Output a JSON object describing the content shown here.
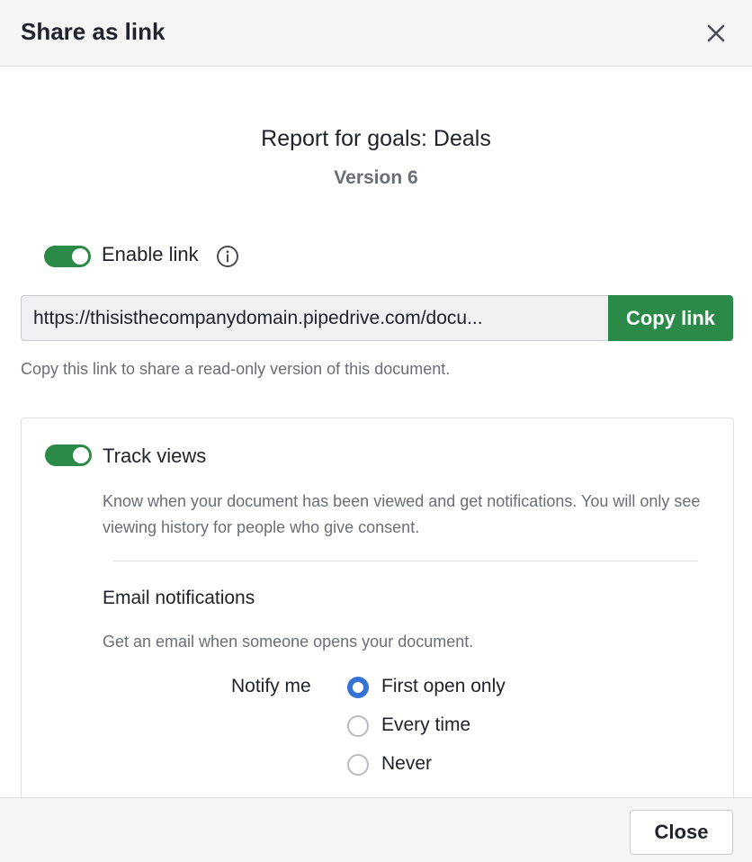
{
  "dialog": {
    "title": "Share as link",
    "close_button_label": "Close"
  },
  "document": {
    "title": "Report for goals: Deals",
    "version": "Version 6"
  },
  "link": {
    "enable_label": "Enable link",
    "enabled": true,
    "url": "https://thisisthecompanydomain.pipedrive.com/docu...",
    "copy_label": "Copy link",
    "helper": "Copy this link to share a read-only version of this document."
  },
  "tracking": {
    "label": "Track views",
    "enabled": true,
    "description": "Know when your document has been viewed and get notifications. You will only see viewing history for people who give consent.",
    "email_title": "Email notifications",
    "email_description": "Get an email when someone opens your document.",
    "notify_label": "Notify me",
    "options": [
      {
        "label": "First open only",
        "selected": true
      },
      {
        "label": "Every time",
        "selected": false
      },
      {
        "label": "Never",
        "selected": false
      }
    ]
  },
  "icons": {
    "close": "close-icon",
    "info": "info-icon"
  },
  "colors": {
    "accent_green": "#2c8a48",
    "radio_blue": "#3573d5",
    "muted_text": "#6b6e78"
  }
}
